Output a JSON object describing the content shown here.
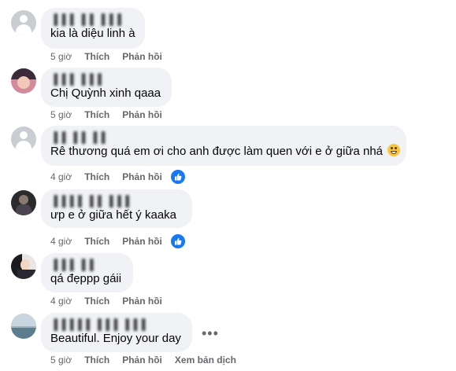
{
  "comments": [
    {
      "author": "▐▐▐ ▐▐ ▐▐▐",
      "text": "kia là diệu linh à",
      "time": "5 giờ",
      "like_label": "Thích",
      "reply_label": "Phản hồi",
      "has_like_badge": false
    },
    {
      "author": "▐▐▐ ▐▐▐",
      "text": "Chị Quỳnh xinh qaaa",
      "time": "5 giờ",
      "like_label": "Thích",
      "reply_label": "Phản hồi",
      "has_like_badge": false
    },
    {
      "author": "▐▐ ▐▐ ▐▐",
      "text": "Rê thương quá em ơi cho anh được làm quen với e ở giữa nhá",
      "time": "4 giờ",
      "like_label": "Thích",
      "reply_label": "Phản hồi",
      "has_like_badge": true,
      "emoji": "grinning-face"
    },
    {
      "author": "▐▐▐▐ ▐▐ ▐▐▐",
      "text": "ưp e ở giữa hết ý kaaka",
      "time": "4 giờ",
      "like_label": "Thích",
      "reply_label": "Phản hồi",
      "has_like_badge": true
    },
    {
      "author": "▐▐▐ ▐▐",
      "text": "qá đẹppp gáii",
      "time": "4 giờ",
      "like_label": "Thích",
      "reply_label": "Phản hồi",
      "has_like_badge": false
    },
    {
      "author": "▐▐▐▐▐ ▐▐▐ ▐▐▐",
      "text": "Beautiful. Enjoy your day",
      "time": "5 giờ",
      "like_label": "Thích",
      "reply_label": "Phản hồi",
      "translate_label": "Xem bản dịch",
      "has_like_badge": false
    }
  ],
  "icons": {
    "like_badge": "thumbs-up-icon",
    "more": "more-options-icon"
  },
  "colors": {
    "bubble": "#f0f2f5",
    "meta_text": "#65676b",
    "like_blue": "#1877f2"
  }
}
